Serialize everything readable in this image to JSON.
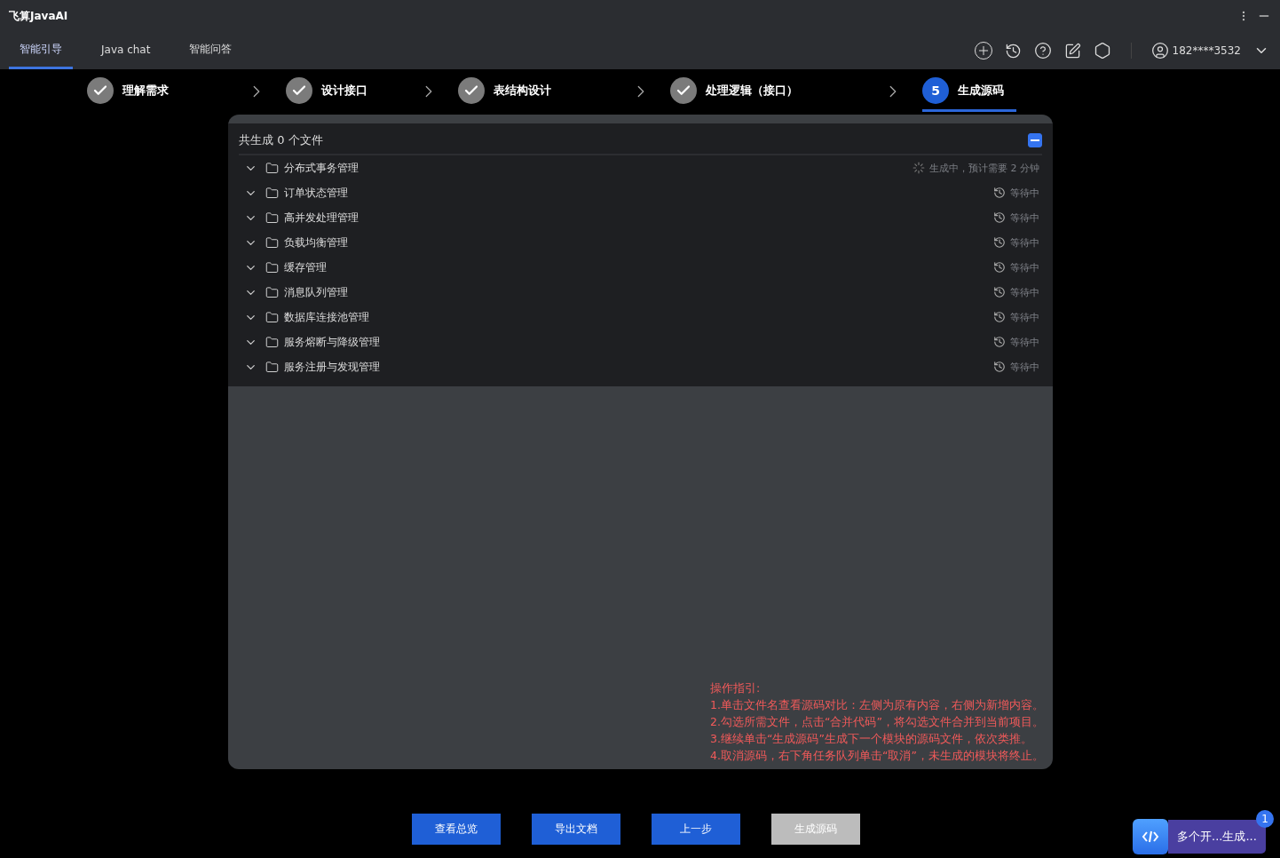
{
  "app_title": "飞算JavaAI",
  "tabs": [
    {
      "label": "智能引导",
      "selected": true
    },
    {
      "label": "Java chat",
      "selected": false
    },
    {
      "label": "智能问答",
      "selected": false
    }
  ],
  "user": {
    "phone": "182****3532"
  },
  "steps": [
    {
      "label": "理解需求",
      "done": true,
      "selected": false
    },
    {
      "label": "设计接口",
      "done": true,
      "selected": false
    },
    {
      "label": "表结构设计",
      "done": true,
      "selected": false
    },
    {
      "label": "处理逻辑（接口）",
      "done": true,
      "selected": false
    },
    {
      "label": "生成源码",
      "done": false,
      "number": "5",
      "selected": true
    }
  ],
  "panel": {
    "summary": "共生成 0 个文件",
    "select_all_partial": true,
    "modules": [
      {
        "name": "分布式事务管理",
        "kind": "generating",
        "status": "生成中，预计需要 2 分钟",
        "expanded": false
      },
      {
        "name": "订单状态管理",
        "kind": "waiting",
        "status": "等待中",
        "expanded": false
      },
      {
        "name": "高并发处理管理",
        "kind": "waiting",
        "status": "等待中",
        "expanded": false
      },
      {
        "name": "负载均衡管理",
        "kind": "waiting",
        "status": "等待中",
        "expanded": false
      },
      {
        "name": "缓存管理",
        "kind": "waiting",
        "status": "等待中",
        "expanded": false
      },
      {
        "name": "消息队列管理",
        "kind": "waiting",
        "status": "等待中",
        "expanded": false
      },
      {
        "name": "数据库连接池管理",
        "kind": "waiting",
        "status": "等待中",
        "expanded": false
      },
      {
        "name": "服务熔断与降级管理",
        "kind": "waiting",
        "status": "等待中",
        "expanded": false
      },
      {
        "name": "服务注册与发现管理",
        "kind": "waiting",
        "status": "等待中",
        "expanded": false
      }
    ],
    "guide": [
      "操作指引:",
      "1.单击文件名查看源码对比：左侧为原有内容，右侧为新增内容。",
      "2.勾选所需文件，点击“合并代码”，将勾选文件合并到当前项目。",
      "3.继续单击“生成源码”生成下一个模块的源码文件，依次类推。",
      "4.取消源码，右下角任务队列单击“取消”，未生成的模块将终止。"
    ]
  },
  "buttons": [
    {
      "label": "查看总览",
      "disabled": false
    },
    {
      "label": "导出文档",
      "disabled": false
    },
    {
      "label": "上一步",
      "disabled": false
    },
    {
      "label": "生成源码",
      "disabled": true
    }
  ],
  "task_queue": {
    "label": "多个开...生成...",
    "count": "1"
  }
}
